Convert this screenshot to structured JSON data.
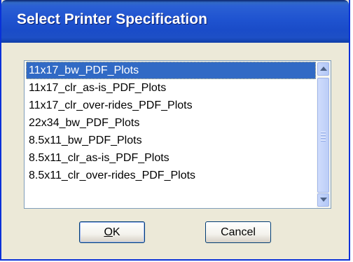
{
  "dialog": {
    "title": "Select Printer Specification"
  },
  "list": {
    "selected_index": 0,
    "items": [
      "11x17_bw_PDF_Plots",
      "11x17_clr_as-is_PDF_Plots",
      "11x17_clr_over-rides_PDF_Plots",
      "22x34_bw_PDF_Plots",
      "8.5x11_bw_PDF_Plots",
      "8.5x11_clr_as-is_PDF_Plots",
      "8.5x11_clr_over-rides_PDF_Plots"
    ]
  },
  "buttons": {
    "ok_access": "O",
    "ok_rest": "K",
    "cancel_label": "Cancel"
  },
  "colors": {
    "titlebar": "#1f53d0",
    "selection": "#316ac5",
    "dialog_bg": "#ece9d8"
  },
  "icons": [
    "scroll-up-icon",
    "scroll-down-icon",
    "scroll-grip-icon"
  ]
}
